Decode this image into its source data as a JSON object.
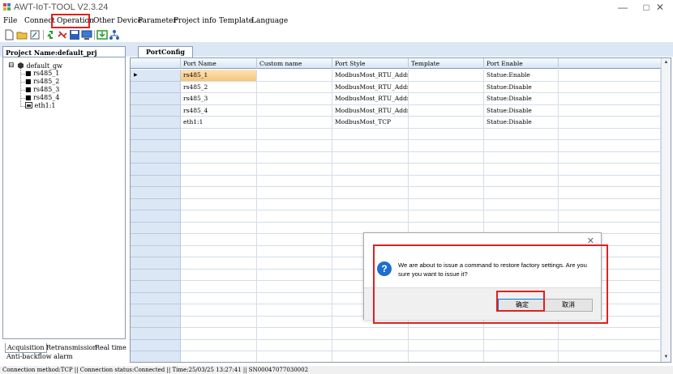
{
  "window": {
    "title": "AWT-IoT-TOOL V2.3.24",
    "minimize_glyph": "—",
    "maximize_glyph": "□",
    "close_glyph": "✕"
  },
  "menu": {
    "items": [
      "File",
      "Connect",
      "Operation",
      "Other Device",
      "Parameter",
      "Project info",
      "Template",
      "Language"
    ],
    "highlighted": "Operation",
    "highlight_color": "#e02020"
  },
  "toolbar": {
    "icons": [
      "new-file-icon",
      "open-folder-icon",
      "edit-icon",
      "connect-link-icon",
      "disconnect-link-icon",
      "save-icon",
      "monitor-icon",
      "download-icon",
      "network-icon"
    ]
  },
  "project": {
    "header": "Project Name:default_prj",
    "tree": {
      "root": "default_gw",
      "toggle": "⊟",
      "children": [
        "rs485_1",
        "rs485_2",
        "rs485_3",
        "rs485_4",
        "eth1:1"
      ]
    }
  },
  "left_tabs": [
    "Acquisition",
    "Retransmission",
    "Real time",
    "Anti-backflow alarm"
  ],
  "main_tab": "PortConfig",
  "grid": {
    "columns": [
      "Port Name",
      "Custom name",
      "Port Style",
      "Template",
      "Port Enable"
    ],
    "rows": [
      {
        "port_name": "rs485_1",
        "custom_name": "",
        "port_style": "ModbusMost_RTU_Addr",
        "template": "",
        "port_enable": "Statue:Enable"
      },
      {
        "port_name": "rs485_2",
        "custom_name": "",
        "port_style": "ModbusMost_RTU_Addr",
        "template": "",
        "port_enable": "Statue:Disable"
      },
      {
        "port_name": "rs485_3",
        "custom_name": "",
        "port_style": "ModbusMost_RTU_Addr",
        "template": "",
        "port_enable": "Statue:Disable"
      },
      {
        "port_name": "rs485_4",
        "custom_name": "",
        "port_style": "ModbusMost_RTU_Addr",
        "template": "",
        "port_enable": "Statue:Disable"
      },
      {
        "port_name": "eth1:1",
        "custom_name": "",
        "port_style": "ModbusMost_TCP",
        "template": "",
        "port_enable": "Statue:Disable"
      }
    ],
    "selected_row_marker": "▶",
    "selection_color": "#f6c67a"
  },
  "dialog": {
    "message": "We are about to issue a command to restore factory settings. Are you sure you want to issue it?",
    "icon": "question-icon",
    "icon_glyph": "?",
    "close_glyph": "✕",
    "ok_label": "确定",
    "cancel_label": "取消",
    "highlight_color": "#e02020"
  },
  "statusbar": {
    "text": "Connection method:TCP || Connection status:Connected || Time:25/03/25 13:27:41 || SN00047077030002"
  }
}
